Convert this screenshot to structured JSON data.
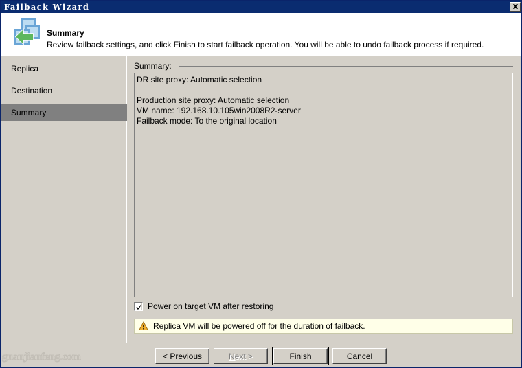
{
  "window": {
    "title": "Failback Wizard",
    "close_icon": "close-icon",
    "accent_titlebar": "#0a2c70",
    "face_color": "#d4d0c8"
  },
  "header": {
    "icon": "failback-replica-arrow-icon",
    "title": "Summary",
    "subtitle": "Review failback settings, and click Finish to start failback operation. You will be able to undo failback process if required."
  },
  "sidebar": {
    "items": [
      {
        "label": "Replica",
        "selected": false
      },
      {
        "label": "Destination",
        "selected": false
      },
      {
        "label": "Summary",
        "selected": true
      }
    ],
    "selected_bg": "#808080"
  },
  "main": {
    "summary_label": "Summary:",
    "summary_lines": [
      "DR site proxy: Automatic selection",
      "",
      "Production site proxy: Automatic selection",
      "VM name: 192.168.10.105win2008R2-server",
      "Failback mode: To the original location"
    ],
    "checkbox": {
      "label": "Power on target VM after restoring",
      "accelerator": "P",
      "checked": true
    },
    "warning": {
      "icon": "warning-triangle-icon",
      "text": "Replica VM will be powered off for the duration of failback.",
      "background": "#ffffe8",
      "border": "#c8c8a8"
    }
  },
  "footer": {
    "buttons": [
      {
        "label": "< Previous",
        "accelerator": "P",
        "state": "enabled",
        "default": false
      },
      {
        "label": "Next >",
        "accelerator": "N",
        "state": "disabled",
        "default": false
      },
      {
        "label": "Finish",
        "accelerator": "F",
        "state": "enabled",
        "default": true
      },
      {
        "label": "Cancel",
        "accelerator": "",
        "state": "enabled",
        "default": false
      }
    ]
  },
  "watermark": {
    "text": "guanjianfeng.com"
  }
}
